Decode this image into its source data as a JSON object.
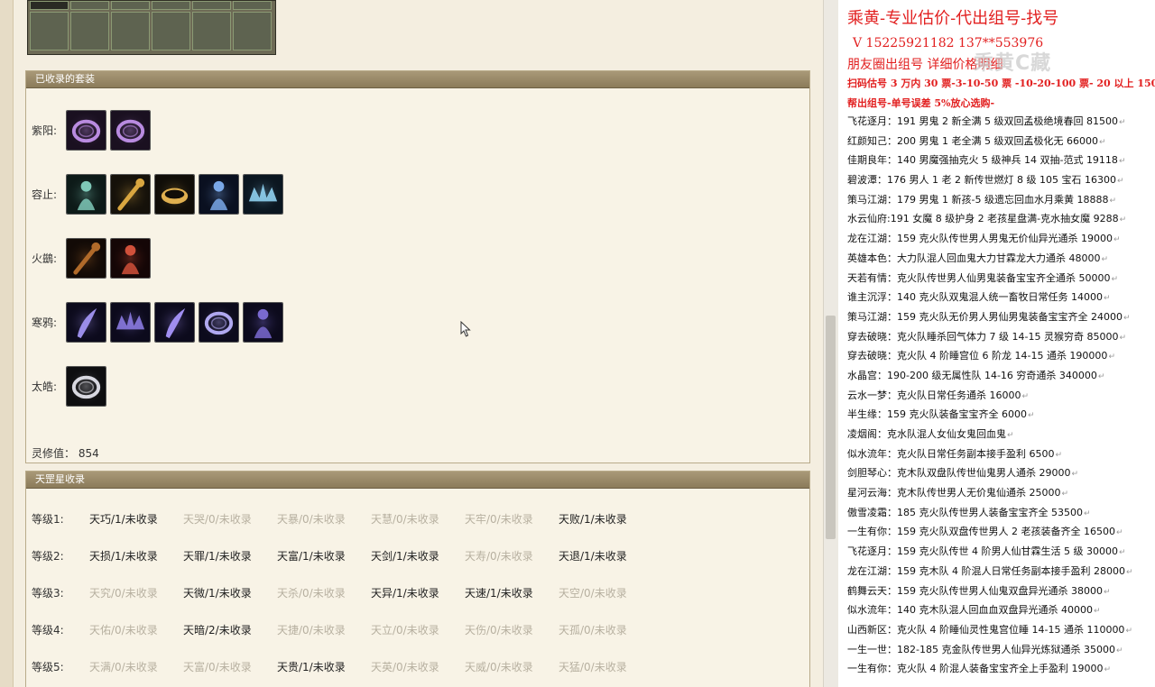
{
  "panels": {
    "suits_title": "已收录的套装",
    "stars_title": "天罡星收录"
  },
  "suits": [
    {
      "label": "紫阳:",
      "icons": [
        "purple-ring-icon",
        "purple-ring-icon"
      ]
    },
    {
      "label": "容止:",
      "icons": [
        "jade-figure-icon",
        "gold-staff-icon",
        "gold-ring-icon",
        "blue-spirit-icon",
        "ice-crown-icon"
      ]
    },
    {
      "label": "火鷀:",
      "icons": [
        "dark-feather-icon",
        "red-figure-icon"
      ]
    },
    {
      "label": "寒鸦:",
      "icons": [
        "violet-blade-icon",
        "violet-wing-icon",
        "violet-sword-icon",
        "violet-ring-icon",
        "violet-armor-icon"
      ]
    },
    {
      "label": "太皓:",
      "icons": [
        "silver-ring-icon"
      ]
    }
  ],
  "spirit_value": "灵修值： 854",
  "stars": [
    {
      "label": "等级1:",
      "items": [
        {
          "text": "天巧/1/未收录",
          "dim": false
        },
        {
          "text": "天哭/0/未收录",
          "dim": true
        },
        {
          "text": "天暴/0/未收录",
          "dim": true
        },
        {
          "text": "天慧/0/未收录",
          "dim": true
        },
        {
          "text": "天牢/0/未收录",
          "dim": true
        },
        {
          "text": "天败/1/未收录",
          "dim": false
        }
      ]
    },
    {
      "label": "等级2:",
      "items": [
        {
          "text": "天损/1/未收录",
          "dim": false
        },
        {
          "text": "天罪/1/未收录",
          "dim": false
        },
        {
          "text": "天富/1/未收录",
          "dim": false
        },
        {
          "text": "天剑/1/未收录",
          "dim": false
        },
        {
          "text": "天寿/0/未收录",
          "dim": true
        },
        {
          "text": "天退/1/未收录",
          "dim": false
        }
      ]
    },
    {
      "label": "等级3:",
      "items": [
        {
          "text": "天究/0/未收录",
          "dim": true
        },
        {
          "text": "天微/1/未收录",
          "dim": false
        },
        {
          "text": "天杀/0/未收录",
          "dim": true
        },
        {
          "text": "天异/1/未收录",
          "dim": false
        },
        {
          "text": "天速/1/未收录",
          "dim": false
        },
        {
          "text": "天空/0/未收录",
          "dim": true
        }
      ]
    },
    {
      "label": "等级4:",
      "items": [
        {
          "text": "天佑/0/未收录",
          "dim": true
        },
        {
          "text": "天暗/2/未收录",
          "dim": false
        },
        {
          "text": "天捷/0/未收录",
          "dim": true
        },
        {
          "text": "天立/0/未收录",
          "dim": true
        },
        {
          "text": "天伤/0/未收录",
          "dim": true
        },
        {
          "text": "天孤/0/未收录",
          "dim": true
        }
      ]
    },
    {
      "label": "等级5:",
      "items": [
        {
          "text": "天满/0/未收录",
          "dim": true
        },
        {
          "text": "天富/0/未收录",
          "dim": true
        },
        {
          "text": "天贵/1/未收录",
          "dim": false
        },
        {
          "text": "天英/0/未收录",
          "dim": true
        },
        {
          "text": "天威/0/未收录",
          "dim": true
        },
        {
          "text": "天猛/0/未收录",
          "dim": true
        }
      ]
    }
  ],
  "right": {
    "title": "乘黄-专业估价-代出组号-找号",
    "phone": "V 15225921182    137**553976",
    "circle": "朋友圈出组号    详细价格明细",
    "price_rule": "扫码估号 3 万内 30 票-3-10-50 票  -10-20-100 票- 20 以上 150",
    "bind_rule": "帮出组号-单号误差 5%放心选购-",
    "watermark": "乘黄C藏",
    "listings": [
      "飞花逐月：191 男鬼 2 新全满 5 级双回孟极绝境春回 81500",
      "红颜知己：200 男鬼 1 老全满 5 级双回孟极化无 66000",
      "佳期良年：140 男魔强抽克火 5 级神兵 14 双抽-范式 19118",
      "碧波潭：176 男人 1 老 2 新传世燃灯 8 级 105 宝石 16300",
      "策马江湖：179 男鬼 1 新孩-5 级遗忘回血水月乘黄 18888",
      "水云仙府:191 女魔 8 级护身 2 老孩星盘满-克水抽女魔 9288",
      "龙在江湖：159 克火队传世男人男鬼无价仙异光通杀 19000",
      "英雄本色：大力队混人回血鬼大力甘霖龙大力通杀 48000",
      "天若有情：克火队传世男人仙男鬼装备宝宝齐全通杀 50000",
      "谁主沉浮：140 克火队双鬼混人统一畜牧日常任务 14000",
      "策马江湖：159 克火队无价男人男仙男鬼装备宝宝齐全 24000",
      "穿去破晓：克火队睡杀回气体力 7 级 14-15 灵猴穷奇 85000",
      "穿去破晓：克火队 4 阶睡宫位 6 阶龙 14-15 通杀 190000",
      "水晶宫：190-200 级无属性队 14-16 穷奇通杀 340000",
      "云水一梦：克火队日常任务通杀 16000",
      "半生缘：159 克火队装备宝宝齐全 6000",
      "凌烟阁：克水队混人女仙女鬼回血鬼",
      "似水流年：克火队日常任务副本接手盈利 6500",
      "剑胆琴心：克木队双盘队传世仙鬼男人通杀 29000",
      "星河云海：克木队传世男人无价鬼仙通杀 25000",
      "傲雪凌霜：185 克火队传世男人装备宝宝齐全 53500",
      "一生有你：159 克火队双盘传世男人 2 老孩装备齐全 16500",
      "飞花逐月：159 克火队传世 4 阶男人仙甘霖生活 5 级 30000",
      "龙在江湖：159 克木队 4 阶混人日常任务副本接手盈利 28000",
      "鹤舞云天：159 克火队传世男人仙鬼双盘异光通杀 38000",
      "似水流年：140 克木队混人回血血双盘异光通杀 40000",
      "山西新区：克火队 4 阶睡仙灵性鬼宫位睡 14-15 通杀 110000",
      "一生一世：182-185 克金队传世男人仙异光炼狱通杀 35000",
      "一生有你：克火队 4 阶混人装备宝宝齐全上手盈利 19000"
    ]
  }
}
